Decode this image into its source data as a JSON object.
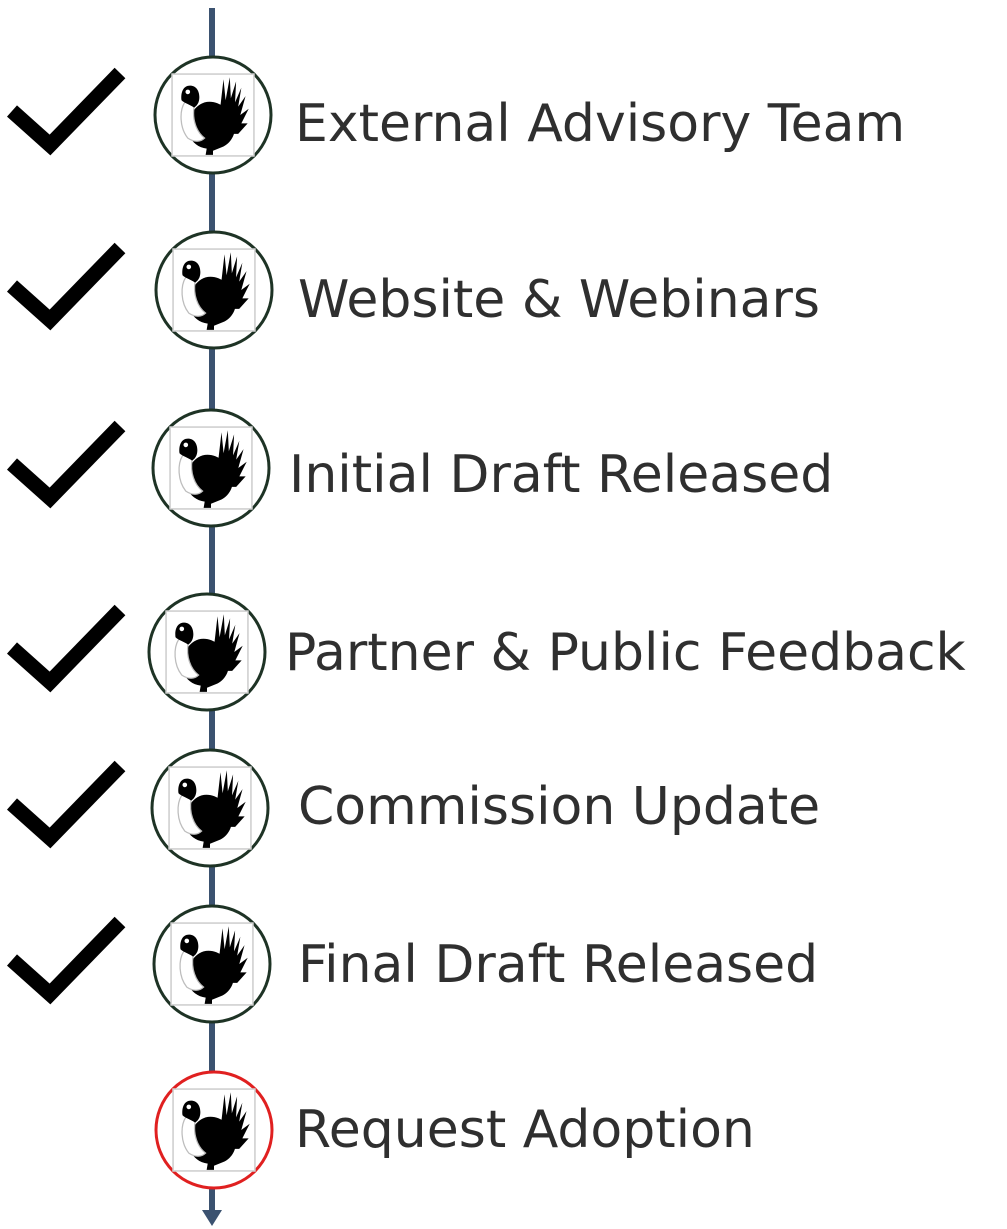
{
  "colors": {
    "line": "#3b5270",
    "check": "#000000",
    "completed_ring": "#1e3325",
    "pending_ring": "#e02020",
    "text": "#2f2f2f"
  },
  "icons": {
    "step_icon": "sage-grouse-icon",
    "completed_marker": "checkmark-icon"
  },
  "steps": [
    {
      "label": "External Advisory Team",
      "completed": true
    },
    {
      "label": "Website & Webinars",
      "completed": true
    },
    {
      "label": "Initial Draft Released",
      "completed": true
    },
    {
      "label": "Partner & Public Feedback",
      "completed": true
    },
    {
      "label": "Commission Update",
      "completed": true
    },
    {
      "label": "Final Draft Released",
      "completed": true
    },
    {
      "label": "Request Adoption",
      "completed": false
    }
  ]
}
